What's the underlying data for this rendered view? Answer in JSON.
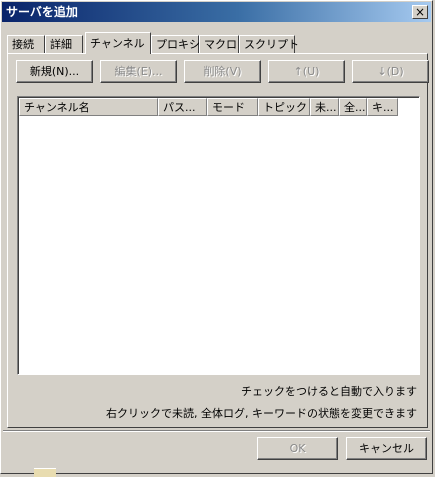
{
  "window": {
    "title": "サーバを追加",
    "close_glyph": "×"
  },
  "tabs": [
    {
      "label": "接続"
    },
    {
      "label": "詳細"
    },
    {
      "label": "チャンネル"
    },
    {
      "label": "プロキシ"
    },
    {
      "label": "マクロ"
    },
    {
      "label": "スクリプト"
    }
  ],
  "active_tab": "チャンネル",
  "toolbar": {
    "new_label": "新規(N)...",
    "edit_label": "編集(E)...",
    "delete_label": "削除(V)",
    "up_label": "↑(U)",
    "down_label": "↓(D)"
  },
  "list": {
    "columns": [
      {
        "label": "チャンネル名"
      },
      {
        "label": "パス..."
      },
      {
        "label": "モード"
      },
      {
        "label": "トピック"
      },
      {
        "label": "未..."
      },
      {
        "label": "全..."
      },
      {
        "label": "キ..."
      }
    ],
    "rows": []
  },
  "hints": {
    "line1": "チェックをつけると自動で入ります",
    "line2": "右クリックで未読, 全体ログ, キーワードの状態を変更できます"
  },
  "footer": {
    "ok_label": "OK",
    "cancel_label": "キャンセル"
  }
}
